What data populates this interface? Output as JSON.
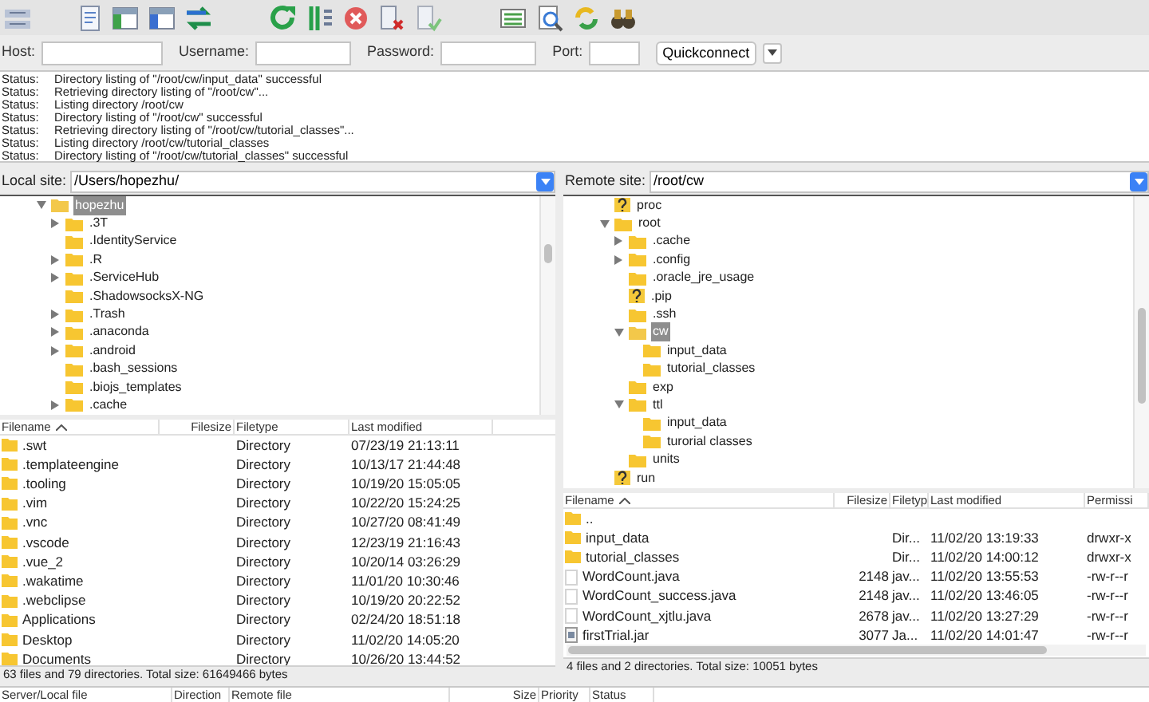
{
  "connection": {
    "fields": [
      {
        "label": "Host:"
      },
      {
        "label": "Username:"
      },
      {
        "label": "Password:"
      },
      {
        "label": "Port:"
      }
    ],
    "quickconnect": "Quickconnect"
  },
  "log": [
    {
      "label": "Status:",
      "message": "Directory listing of \"/root/cw/input_data\" successful"
    },
    {
      "label": "Status:",
      "message": "Retrieving directory listing of \"/root/cw\"..."
    },
    {
      "label": "Status:",
      "message": "Listing directory /root/cw"
    },
    {
      "label": "Status:",
      "message": "Directory listing of \"/root/cw\" successful"
    },
    {
      "label": "Status:",
      "message": "Retrieving directory listing of \"/root/cw/tutorial_classes\"..."
    },
    {
      "label": "Status:",
      "message": "Listing directory /root/cw/tutorial_classes"
    },
    {
      "label": "Status:",
      "message": "Directory listing of \"/root/cw/tutorial_classes\" successful"
    }
  ],
  "local": {
    "site_label": "Local site:",
    "path": "/Users/hopezhu/",
    "tree": [
      {
        "name": "hopezhu",
        "kind": "folder",
        "expanded": true,
        "selected": true,
        "children": [
          {
            "name": ".3T",
            "kind": "folder",
            "expanded": false,
            "selected": false
          },
          {
            "name": ".IdentityService",
            "kind": "folder",
            "selected": false
          },
          {
            "name": ".R",
            "kind": "folder",
            "expanded": false,
            "selected": false
          },
          {
            "name": ".ServiceHub",
            "kind": "folder",
            "expanded": false,
            "selected": false
          },
          {
            "name": ".ShadowsocksX-NG",
            "kind": "folder",
            "selected": false
          },
          {
            "name": ".Trash",
            "kind": "folder",
            "expanded": false,
            "selected": false
          },
          {
            "name": ".anaconda",
            "kind": "folder",
            "expanded": false,
            "selected": false
          },
          {
            "name": ".android",
            "kind": "folder",
            "expanded": false,
            "selected": false
          },
          {
            "name": ".bash_sessions",
            "kind": "folder",
            "selected": false
          },
          {
            "name": ".biojs_templates",
            "kind": "folder",
            "selected": false
          },
          {
            "name": ".cache",
            "kind": "folder",
            "expanded": false,
            "selected": false
          }
        ]
      }
    ],
    "columns": [
      "Filename",
      "Filesize",
      "Filetype",
      "Last modified"
    ],
    "rows": [
      {
        "kind": "folder",
        "name": ".swt",
        "size": "",
        "type": "Directory",
        "modified": "07/23/19 21:13:11"
      },
      {
        "kind": "folder",
        "name": ".templateengine",
        "type": "Directory",
        "modified": "10/13/17 21:44:48"
      },
      {
        "kind": "folder",
        "name": ".tooling",
        "type": "Directory",
        "modified": "10/19/20 15:05:05"
      },
      {
        "kind": "folder",
        "name": ".vim",
        "type": "Directory",
        "modified": "10/22/20 15:24:25"
      },
      {
        "kind": "folder",
        "name": ".vnc",
        "type": "Directory",
        "modified": "10/27/20 08:41:49"
      },
      {
        "kind": "folder",
        "name": ".vscode",
        "type": "Directory",
        "modified": "12/23/19 21:16:43"
      },
      {
        "kind": "folder",
        "name": ".vue_2",
        "type": "Directory",
        "modified": "10/20/14 03:26:29"
      },
      {
        "kind": "folder",
        "name": ".wakatime",
        "type": "Directory",
        "modified": "11/01/20 10:30:46"
      },
      {
        "kind": "folder",
        "name": ".webclipse",
        "type": "Directory",
        "modified": "10/19/20 20:22:52"
      },
      {
        "kind": "folder",
        "name": "Applications",
        "type": "Directory",
        "modified": "02/24/20 18:51:18"
      },
      {
        "kind": "folder",
        "name": "Desktop",
        "type": "Directory",
        "modified": "11/02/20 14:05:20"
      },
      {
        "kind": "folder",
        "name": "Documents",
        "type": "Directory",
        "modified": "10/26/20 13:44:52"
      }
    ],
    "status": "63 files and 79 directories. Total size: 61649466 bytes"
  },
  "remote": {
    "site_label": "Remote site:",
    "path": "/root/cw",
    "tree": [
      {
        "name": "proc",
        "kind": "unknown",
        "selected": false
      },
      {
        "name": "root",
        "kind": "folder",
        "expanded": true,
        "selected": false,
        "children": [
          {
            "name": ".cache",
            "kind": "folder",
            "expanded": false,
            "selected": false
          },
          {
            "name": ".config",
            "kind": "folder",
            "expanded": false,
            "selected": false
          },
          {
            "name": ".oracle_jre_usage",
            "kind": "folder",
            "selected": false
          },
          {
            "name": ".pip",
            "kind": "unknown",
            "selected": false
          },
          {
            "name": ".ssh",
            "kind": "folder",
            "selected": false
          },
          {
            "name": "cw",
            "kind": "folder",
            "expanded": true,
            "selected": true,
            "children": [
              {
                "name": "input_data",
                "kind": "folder",
                "selected": false
              },
              {
                "name": "tutorial_classes",
                "kind": "folder",
                "selected": false
              }
            ]
          },
          {
            "name": "exp",
            "kind": "folder",
            "selected": false
          },
          {
            "name": "ttl",
            "kind": "folder",
            "expanded": true,
            "selected": false,
            "children": [
              {
                "name": "input_data",
                "kind": "folder",
                "selected": false
              },
              {
                "name": "turorial classes",
                "kind": "folder",
                "selected": false
              }
            ]
          },
          {
            "name": "units",
            "kind": "folder",
            "selected": false
          }
        ]
      },
      {
        "name": "run",
        "kind": "unknown",
        "selected": false
      }
    ],
    "columns": [
      "Filename",
      "Filesize",
      "Filetyp",
      "Last modified",
      "Permissi"
    ],
    "rows": [
      {
        "kind": "folder",
        "name": ".."
      },
      {
        "kind": "folder",
        "name": "input_data",
        "type": "Dir...",
        "modified": "11/02/20 13:19:33",
        "permissions": "drwxr-x"
      },
      {
        "kind": "folder",
        "name": "tutorial_classes",
        "type": "Dir...",
        "modified": "11/02/20 14:00:12",
        "permissions": "drwxr-x"
      },
      {
        "kind": "file",
        "name": "WordCount.java",
        "size": "2148",
        "type": "jav...",
        "modified": "11/02/20 13:55:53",
        "permissions": "-rw-r--r"
      },
      {
        "kind": "file",
        "name": "WordCount_success.java",
        "size": "2148",
        "type": "jav...",
        "modified": "11/02/20 13:46:05",
        "permissions": "-rw-r--r"
      },
      {
        "kind": "file",
        "name": "WordCount_xjtlu.java",
        "size": "2678",
        "type": "jav...",
        "modified": "11/02/20 13:27:29",
        "permissions": "-rw-r--r"
      },
      {
        "kind": "jar",
        "name": "firstTrial.jar",
        "size": "3077",
        "type": "Ja...",
        "modified": "11/02/20 14:01:47",
        "permissions": "-rw-r--r"
      }
    ],
    "status": "4 files and 2 directories. Total size: 10051 bytes"
  },
  "queue": {
    "columns": [
      "Server/Local file",
      "Direction",
      "Remote file",
      "Size",
      "Priority",
      "Status"
    ]
  }
}
